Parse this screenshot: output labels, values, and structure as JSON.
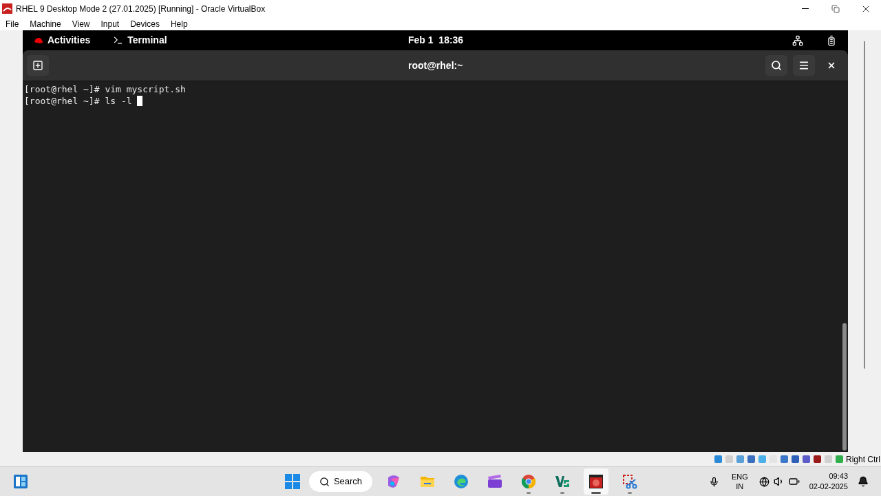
{
  "window": {
    "title": "RHEL 9 Desktop Mode 2 (27.01.2025) [Running] - Oracle VirtualBox"
  },
  "menu": [
    "File",
    "Machine",
    "View",
    "Input",
    "Devices",
    "Help"
  ],
  "gnome_bar": {
    "activities": "Activities",
    "app": "Terminal",
    "clock": "Feb 1  18:36"
  },
  "terminal": {
    "title": "root@rhel:~",
    "lines": [
      {
        "prompt": "[root@rhel ~]#",
        "command": "vim myscript.sh",
        "cursor": false
      },
      {
        "prompt": "[root@rhel ~]#",
        "command": "ls -l",
        "cursor": true
      }
    ]
  },
  "status_bar": {
    "host_key": "Right Ctrl"
  },
  "taskbar": {
    "search": "Search",
    "apps": [
      {
        "kind": "copilot",
        "running": false,
        "selected": false
      },
      {
        "kind": "files",
        "running": false,
        "selected": false
      },
      {
        "kind": "edge",
        "running": false,
        "selected": false
      },
      {
        "kind": "clapper",
        "running": false,
        "selected": false
      },
      {
        "kind": "chrome",
        "running": true,
        "selected": false
      },
      {
        "kind": "vs",
        "running": true,
        "selected": false
      },
      {
        "kind": "virtualbox",
        "running": true,
        "selected": true
      },
      {
        "kind": "snip",
        "running": true,
        "selected": false
      }
    ],
    "language": [
      "ENG",
      "IN"
    ],
    "time": "09:43",
    "date": "02-02-2025"
  }
}
